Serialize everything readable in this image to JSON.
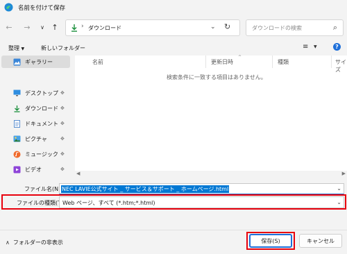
{
  "window": {
    "title": "名前を付けて保存"
  },
  "nav": {
    "path": "ダウンロード",
    "search_placeholder": "ダウンロードの検索"
  },
  "toolbar": {
    "organize": "整理",
    "new_folder": "新しいフォルダー"
  },
  "sidebar": {
    "gallery": "ギャラリー",
    "items": [
      {
        "label": "デスクトップ",
        "icon": "desktop-icon"
      },
      {
        "label": "ダウンロード",
        "icon": "download-icon"
      },
      {
        "label": "ドキュメント",
        "icon": "document-icon"
      },
      {
        "label": "ピクチャ",
        "icon": "picture-icon"
      },
      {
        "label": "ミュージック",
        "icon": "music-icon"
      },
      {
        "label": "ビデオ",
        "icon": "video-icon"
      }
    ]
  },
  "list": {
    "columns": {
      "name": "名前",
      "date": "更新日時",
      "type": "種類",
      "size": "サイズ"
    },
    "empty_message": "検索条件に一致する項目はありません。"
  },
  "form": {
    "filename_label": "ファイル名(N):",
    "filename_value": "NEC LAVIE公式サイト _ サービス＆サポート _ ホームページ.html",
    "filetype_label": "ファイルの種類(T):",
    "filetype_value": "Web ページ、すべて (*.htm;*.html)"
  },
  "footer": {
    "hide_folders": "フォルダーの非表示",
    "save": "保存(S)",
    "cancel": "キャンセル"
  },
  "colors": {
    "accent": "#0078d4",
    "highlight": "#e8000d",
    "download_green": "#1a8f3c"
  }
}
